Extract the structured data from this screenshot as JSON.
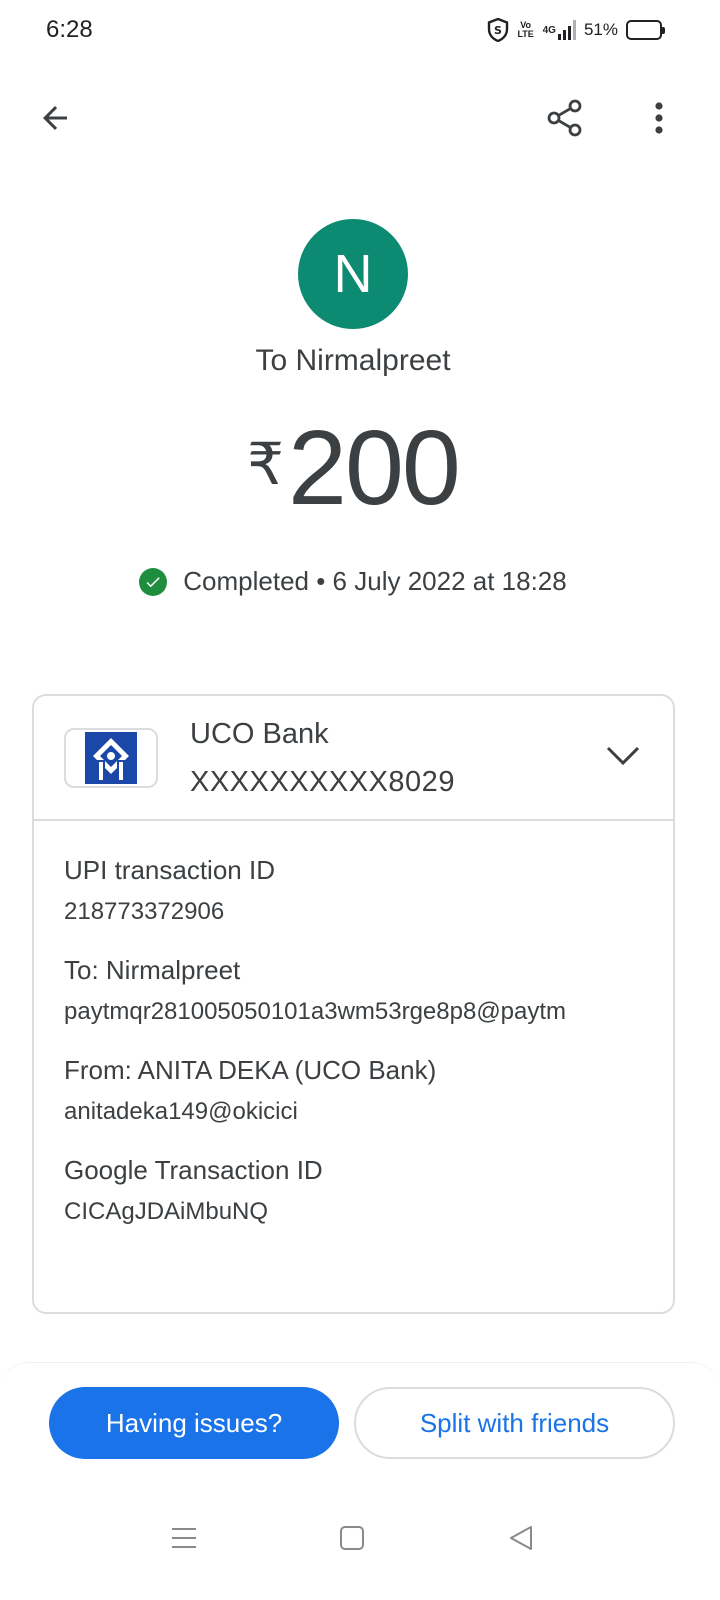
{
  "status_bar": {
    "time": "6:28",
    "network": "4G",
    "volte": "Vo LTE",
    "battery": "51%",
    "battery_level": 0.51
  },
  "app_bar": {
    "back_icon": "arrow-back-icon",
    "share_icon": "share-icon",
    "more_icon": "more-vert-icon"
  },
  "payment": {
    "avatar_initial": "N",
    "avatar_color": "#0d8a72",
    "to_label": "To Nirmalpreet",
    "currency_symbol": "₹",
    "amount": "200",
    "status": "Completed • 6 July 2022 at 18:28",
    "status_color": "#1e8e3e"
  },
  "bank": {
    "name": "UCO Bank",
    "account": "XXXXXXXXXX8029",
    "logo_color": "#1a47a8"
  },
  "details": {
    "upi_label": "UPI transaction ID",
    "upi_value": "218773372906",
    "to_label": "To: Nirmalpreet",
    "to_value": "paytmqr281005050101a3wm53rge8p8@paytm",
    "from_label": "From: ANITA DEKA (UCO Bank)",
    "from_value": "anitadeka149@okicici",
    "google_label": "Google Transaction ID",
    "google_value": "CICAgJDAiMbuNQ"
  },
  "actions": {
    "issues_label": "Having issues?",
    "split_label": "Split with friends",
    "accent_color": "#1a73e8"
  }
}
